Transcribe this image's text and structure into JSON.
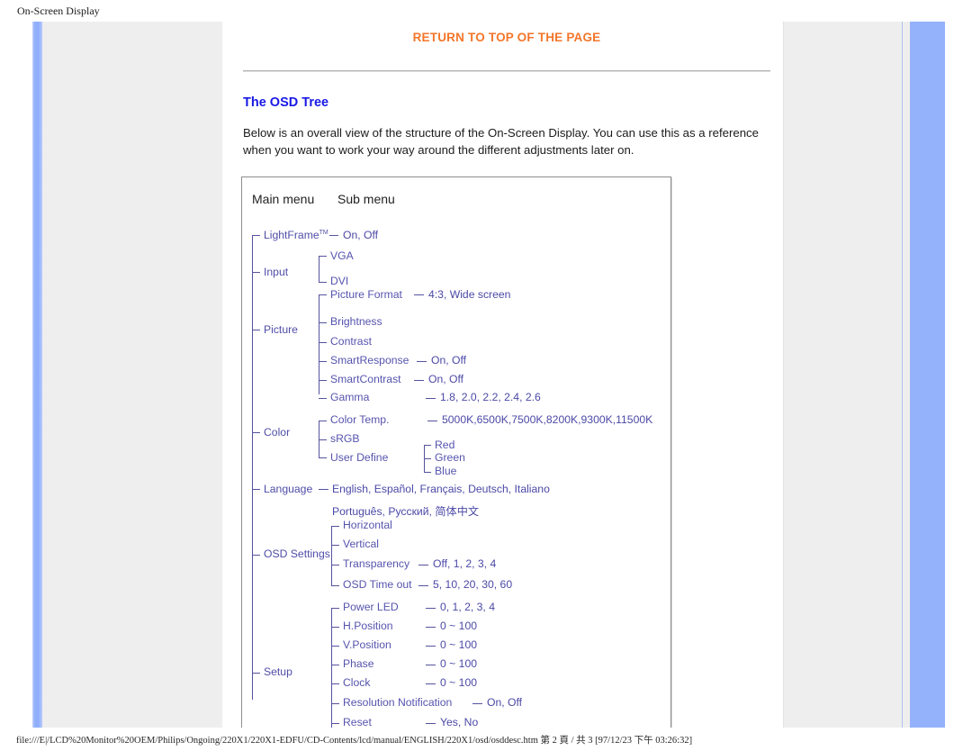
{
  "window": {
    "title": "On-Screen Display"
  },
  "content": {
    "return_link": "RETURN TO TOP OF THE PAGE",
    "section_title": "The OSD Tree",
    "intro": "Below is an overall view of the structure of the On-Screen Display. You can use this as a reference when you want to work your way around the different adjustments later on."
  },
  "tree": {
    "header_main": "Main menu",
    "header_sub": "Sub menu",
    "items": {
      "lightframe": "LightFrame",
      "lightframe_tm": "TM",
      "lightframe_values": "On, Off",
      "input": "Input",
      "input_vga": "VGA",
      "input_dvi": "DVI",
      "picture": "Picture",
      "picture_format": "Picture Format",
      "picture_format_values": "4:3, Wide screen",
      "brightness": "Brightness",
      "contrast": "Contrast",
      "smartresponse": "SmartResponse",
      "smartresponse_values": "On, Off",
      "smartcontrast": "SmartContrast",
      "smartcontrast_values": "On, Off",
      "gamma": "Gamma",
      "gamma_values": "1.8, 2.0, 2.2, 2.4, 2.6",
      "color": "Color",
      "color_temp": "Color Temp.",
      "color_temp_values": "5000K,6500K,7500K,8200K,9300K,11500K",
      "srgb": "sRGB",
      "user_define": "User Define",
      "user_red": "Red",
      "user_green": "Green",
      "user_blue": "Blue",
      "language": "Language",
      "language_values_line1": "English, Español, Français, Deutsch, Italiano",
      "language_values_line2": "Português, Русский, 简体中文",
      "osd_settings": "OSD Settings",
      "osd_horizontal": "Horizontal",
      "osd_vertical": "Vertical",
      "osd_transparency": "Transparency",
      "osd_transparency_values": "Off, 1, 2, 3, 4",
      "osd_timeout": "OSD Time out",
      "osd_timeout_values": "5, 10, 20, 30, 60",
      "setup": "Setup",
      "power_led": "Power LED",
      "power_led_values": "0, 1, 2, 3, 4",
      "h_position": "H.Position",
      "h_position_values": "0 ~ 100",
      "v_position": "V.Position",
      "v_position_values": "0 ~ 100",
      "phase": "Phase",
      "phase_values": "0 ~ 100",
      "clock": "Clock",
      "clock_values": "0 ~ 100",
      "resolution_notification": "Resolution Notification",
      "resolution_notification_values": "On, Off",
      "reset": "Reset",
      "reset_values": "Yes, No"
    }
  },
  "statusbar": {
    "path": "file:///E|/LCD%20Monitor%20OEM/Philips/Ongoing/220X1/220X1-EDFU/CD-Contents/lcd/manual/ENGLISH/220X1/osd/osddesc.htm 第 2 頁 / 共 3 [97/12/23 下午 03:26:32]"
  },
  "colors": {
    "link_orange": "#f4762a",
    "heading_blue": "#1818e6",
    "tree_blue": "#5654ae",
    "sidebar_blue": "#94b2fb",
    "panel_grey": "#eeeeee"
  }
}
